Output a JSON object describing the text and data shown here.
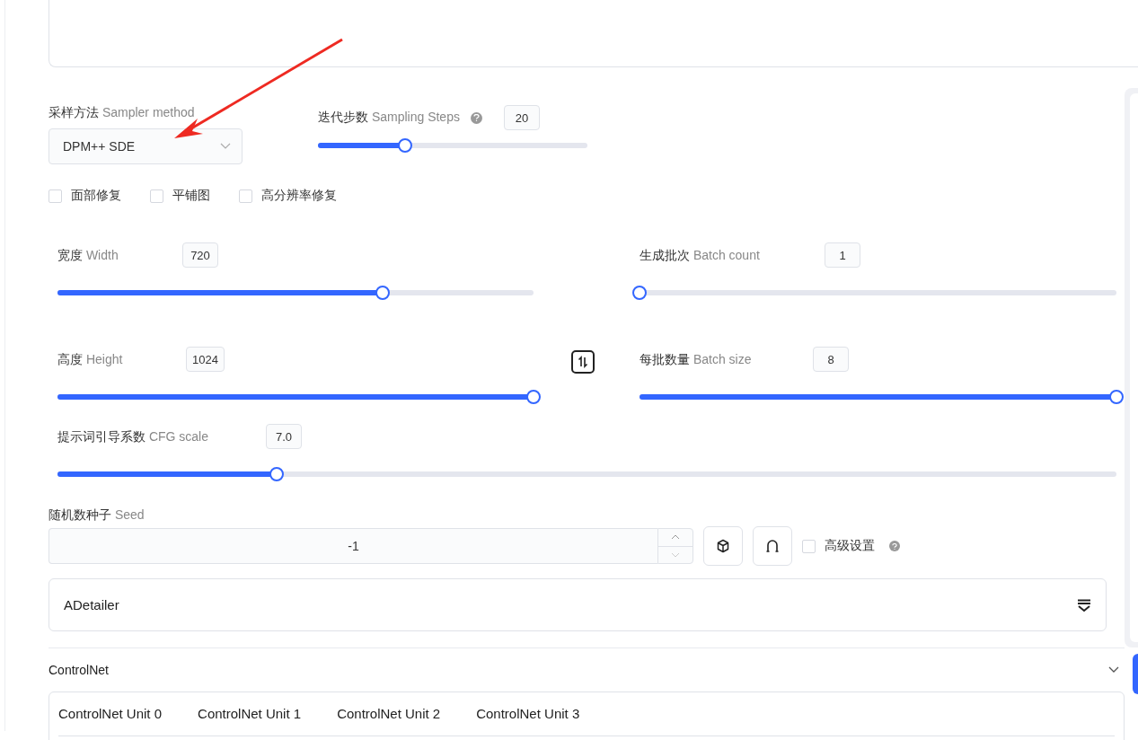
{
  "sampler": {
    "label_zh": "采样方法",
    "label_en": "Sampler method",
    "value": "DPM++ SDE"
  },
  "steps": {
    "label_zh": "迭代步数",
    "label_en": "Sampling Steps",
    "value": "20",
    "level": 0.323
  },
  "options": [
    {
      "label": "面部修复",
      "checked": false
    },
    {
      "label": "平铺图",
      "checked": false
    },
    {
      "label": "高分辨率修复",
      "checked": false
    }
  ],
  "sliders": [
    {
      "label_zh": "宽度",
      "label_en": "Width",
      "value": "720",
      "level": 0.683
    },
    {
      "label_zh": "生成批次",
      "label_en": "Batch count",
      "value": "1",
      "level": 0
    },
    {
      "label_zh": "高度",
      "label_en": "Height",
      "value": "1024",
      "level": 1
    },
    {
      "label_zh": "每批数量",
      "label_en": "Batch size",
      "value": "8",
      "level": 1
    },
    {
      "label_zh": "提示词引导系数",
      "label_en": "CFG scale",
      "value": "7.0",
      "level": 0.207
    }
  ],
  "seed": {
    "label_zh": "随机数种子",
    "label_en": "Seed",
    "value": "-1",
    "advanced": {
      "label": "高级设置",
      "checked": false
    }
  },
  "adetailer": {
    "title": "ADetailer"
  },
  "controlnet": {
    "title": "ControlNet",
    "expanded": true,
    "tabs": [
      {
        "label": "ControlNet Unit 0",
        "selected": false
      },
      {
        "label": "ControlNet Unit 1",
        "selected": false
      },
      {
        "label": "ControlNet Unit 2",
        "selected": false
      },
      {
        "label": "ControlNet Unit 3",
        "selected": false
      }
    ]
  }
}
